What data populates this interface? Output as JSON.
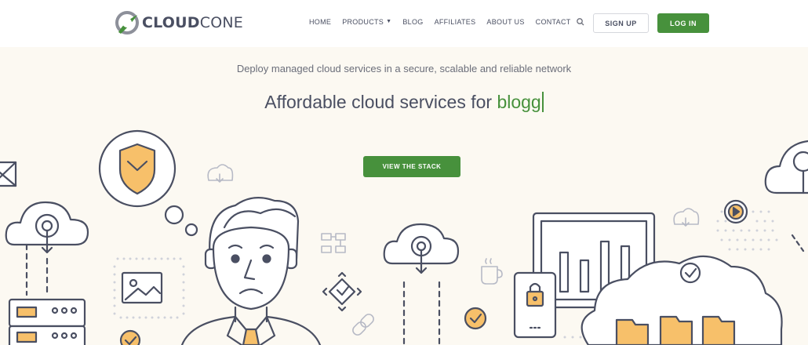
{
  "brand": {
    "name_bold": "CLOUD",
    "name_regular": "CONE",
    "green": "#47913c",
    "text_color": "#4a4f62"
  },
  "nav": {
    "items": [
      {
        "label": "HOME"
      },
      {
        "label": "PRODUCTS"
      },
      {
        "label": "BLOG"
      },
      {
        "label": "AFFILIATES"
      },
      {
        "label": "ABOUT US"
      },
      {
        "label": "CONTACT"
      }
    ],
    "search_icon": "search-icon",
    "signup_label": "SIGN UP",
    "login_label": "LOG IN"
  },
  "hero": {
    "tagline": "Deploy managed cloud services in a secure, scalable and reliable network",
    "headline_prefix": "Affordable cloud services for",
    "headline_typed": "blogg",
    "cta_label": "VIEW THE STACK"
  }
}
